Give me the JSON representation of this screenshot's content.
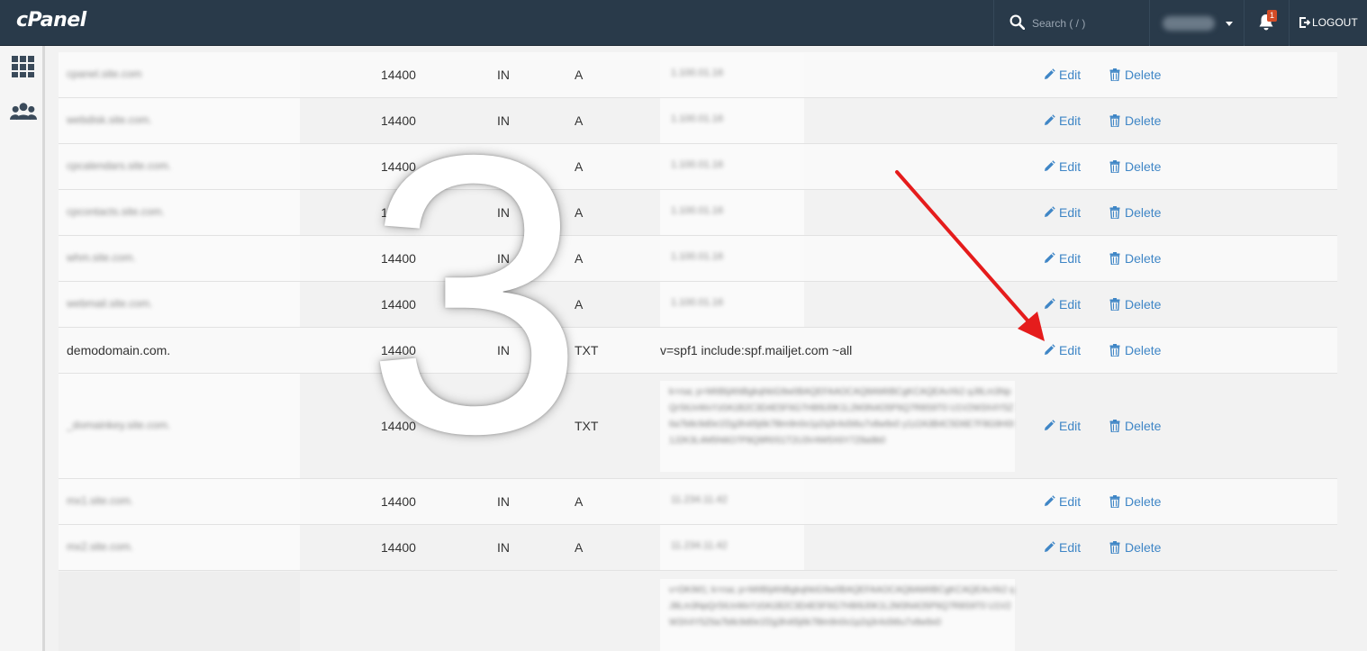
{
  "header": {
    "logo": "cPanel",
    "search_placeholder": "Search ( / )",
    "user_name": "username",
    "notification_count": "1",
    "logout_label": "LOGOUT"
  },
  "sidebar": {
    "items": [
      {
        "icon": "grid-icon"
      },
      {
        "icon": "users-icon"
      }
    ]
  },
  "records": [
    {
      "name": "cpanel.site.com",
      "ttl": "14400",
      "class": "IN",
      "type": "A",
      "record": "1.100.01.16",
      "blurred": true
    },
    {
      "name": "webdisk.site.com.",
      "ttl": "14400",
      "class": "IN",
      "type": "A",
      "record": "1.100.01.16",
      "blurred": true
    },
    {
      "name": "cpcalendars.site.com.",
      "ttl": "14400",
      "class": "IN",
      "type": "A",
      "record": "1.100.01.16",
      "blurred": true
    },
    {
      "name": "cpcontacts.site.com.",
      "ttl": "14400",
      "class": "IN",
      "type": "A",
      "record": "1.100.01.16",
      "blurred": true
    },
    {
      "name": "whm.site.com.",
      "ttl": "14400",
      "class": "IN",
      "type": "A",
      "record": "1.100.01.16",
      "blurred": true
    },
    {
      "name": "webmail.site.com.",
      "ttl": "14400",
      "class": "IN",
      "type": "A",
      "record": "1.100.01.16",
      "blurred": true
    },
    {
      "name": "demodomain.com.",
      "ttl": "14400",
      "class": "IN",
      "type": "TXT",
      "record": "v=spf1 include:spf.mailjet.com ~all",
      "blurred": false
    },
    {
      "name": "_domainkey.site.com.",
      "ttl": "14400",
      "class": "IN",
      "type": "TXT",
      "record": "k=rsa; p=MIIBIjANBgkqhkiG9w0BAQEFAAOCAQ8AMIIBCgKCAQEAvXk2 qJ8Lm3NpQrStUvWxYz0A1B2C3D4E5F6G7H8I9J0K1L2M3N4O5P6Q7R8S9T0 U1V2W3X4Y5Z6a7b8c9d0e1f2g3h4i5j6k7l8m9n0o1p2q3r4s5t6u7v8w9x0 y1z2A3B4C5D6E7F8G9H0I1J2K3L4M5N6O7P8Q9R0S1T2U3V4W5X6Y7Z8a9b0",
      "blurred": true
    },
    {
      "name": "mx1.site.com.",
      "ttl": "14400",
      "class": "IN",
      "type": "A",
      "record": "11.234.11.42",
      "blurred": true
    },
    {
      "name": "mx2.site.com.",
      "ttl": "14400",
      "class": "IN",
      "type": "A",
      "record": "11.234.11.42",
      "blurred": true
    }
  ],
  "last_record_text": "v=DKIM1; k=rsa; p=MIIBIjANBgkqhkiG9w0BAQEFAAOCAQ8AMIIBCgKCAQEAvXk2 qJ8Lm3NpQrStUvWxYz0A1B2C3D4E5F6G7H8I9J0K1L2M3N4O5P6Q7R8S9T0 U1V2W3X4Y5Z6a7b8c9d0e1f2g3h4i5j6k7l8m9n0o1p2q3r4s5t6u7v8w9x0",
  "actions": {
    "edit_label": "Edit",
    "delete_label": "Delete"
  },
  "overlay": {
    "step_number": "3"
  },
  "colors": {
    "topbar": "#293a4a",
    "link": "#3f86c6",
    "arrow": "#e51c1c"
  }
}
